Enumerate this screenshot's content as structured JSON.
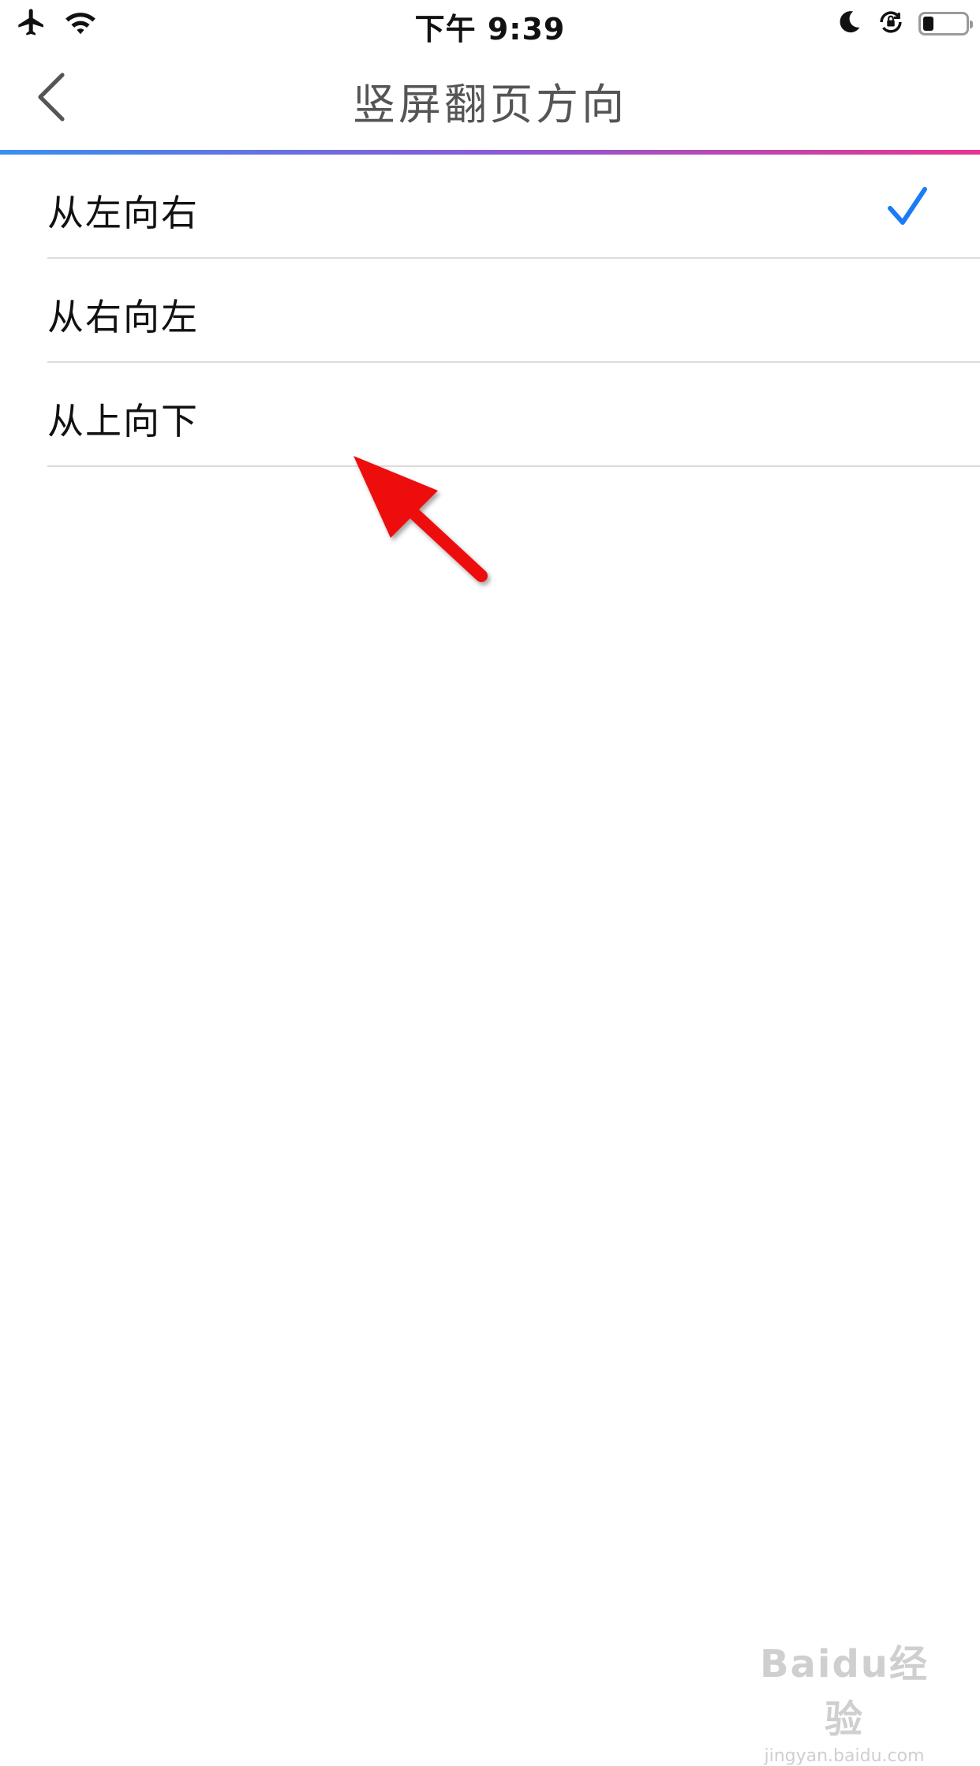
{
  "status_bar": {
    "time": "下午 9:39",
    "battery_level": 0.25,
    "icons": [
      "airplane-icon",
      "wifi-icon",
      "moon-icon",
      "orientation-lock-icon",
      "battery-icon"
    ]
  },
  "nav": {
    "title": "竖屏翻页方向",
    "back_icon": "chevron-left-icon"
  },
  "options": [
    {
      "label": "从左向右",
      "selected": true
    },
    {
      "label": "从右向左",
      "selected": false
    },
    {
      "label": "从上向下",
      "selected": false
    }
  ],
  "colors": {
    "accent": "#1a7cf5",
    "gradient_start": "#3a8ef0",
    "gradient_end": "#e9358f",
    "annotation": "#ee1111"
  },
  "watermark": {
    "logo": "Baidu经验",
    "url": "jingyan.baidu.com"
  }
}
